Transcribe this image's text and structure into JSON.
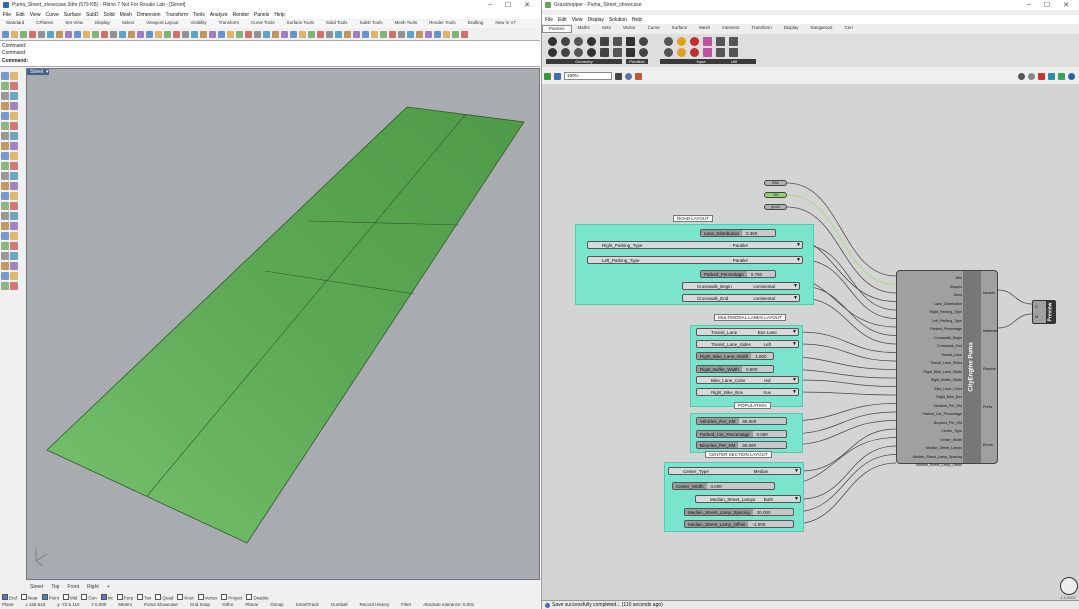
{
  "rhino": {
    "title": "Puma_Street_showcase.3dm (579 KB) - Rhino 7 Not For Resale Lab - [Street]",
    "menu": [
      "File",
      "Edit",
      "View",
      "Curve",
      "Surface",
      "SubD",
      "Solid",
      "Mesh",
      "Dimension",
      "Transform",
      "Tools",
      "Analyze",
      "Render",
      "Panels",
      "Help"
    ],
    "tabs": [
      "Standard",
      "CPlanes",
      "Set View",
      "Display",
      "Select",
      "Viewport Layout",
      "Visibility",
      "Transform",
      "Curve Tools",
      "Surface Tools",
      "Solid Tools",
      "SubD Tools",
      "Mesh Tools",
      "Render Tools",
      "Drafting",
      "New in V7"
    ],
    "command_lines": [
      "Command:",
      "Command:",
      "Command:"
    ],
    "viewport_label": "Street",
    "viewport_tabs": [
      "Street",
      "Top",
      "Front",
      "Right",
      "+"
    ],
    "osnaps": [
      {
        "label": "End",
        "on": true
      },
      {
        "label": "Near",
        "on": false
      },
      {
        "label": "Point",
        "on": true
      },
      {
        "label": "Mid",
        "on": false
      },
      {
        "label": "Cen",
        "on": false
      },
      {
        "label": "Int",
        "on": true
      },
      {
        "label": "Perp",
        "on": false
      },
      {
        "label": "Tan",
        "on": false
      },
      {
        "label": "Quad",
        "on": false
      },
      {
        "label": "Knot",
        "on": false
      },
      {
        "label": "Vertex",
        "on": false
      },
      {
        "label": "Project",
        "on": false
      },
      {
        "label": "Disable",
        "on": false
      }
    ],
    "status": [
      "Plane",
      "x 168.543",
      "y -72.5.110",
      "z 0.000",
      "Meters",
      "Puma Showcase",
      "Grid Snap",
      "Ortho",
      "Planar",
      "Osnap",
      "SmartTrack",
      "Gumball",
      "Record History",
      "Filter",
      "Absolute tolerance: 0.001"
    ],
    "colors": {
      "surface": "#5fae52",
      "viewport_bg": "#a8acb0",
      "surface_edge": "#2f5a2a"
    }
  },
  "grasshopper": {
    "title": "Grasshopper - Puma_Street_showcase",
    "menu": [
      "File",
      "Edit",
      "View",
      "Display",
      "Solution",
      "Help"
    ],
    "tabs": [
      "Params",
      "Maths",
      "Sets",
      "Vector",
      "Curve",
      "Surface",
      "Mesh",
      "Intersect",
      "Transform",
      "Display",
      "Kangaroo2",
      "Ceri"
    ],
    "panel_groups": [
      "Geometry",
      "Primitive",
      "Input",
      "Util"
    ],
    "zoom": "150%",
    "status_message": "Save successfully completed... (110 seconds ago)",
    "version": "1.0.0007",
    "top_nodes": [
      "Bfrk",
      "Srf",
      "proof"
    ],
    "groups": [
      {
        "label": "ROAD LAYOUT",
        "items": [
          {
            "kind": "param",
            "name": "Lane_Distribution",
            "value": "0.350"
          },
          {
            "kind": "dropdown",
            "name": "Right_Parking_Type",
            "value": "Parallel"
          },
          {
            "kind": "dropdown",
            "name": "Left_Parking_Type",
            "value": "Parallel"
          },
          {
            "kind": "param",
            "name": "Parked_Percentage",
            "value": "0.750"
          },
          {
            "kind": "dropdown",
            "name": "Crosswalk_Begin",
            "value": "continental"
          },
          {
            "kind": "dropdown",
            "name": "Crosswalk_End",
            "value": "continental"
          }
        ]
      },
      {
        "label": "MULTIMODAL LANES LAYOUT",
        "items": [
          {
            "kind": "dropdown",
            "name": "Transit_Lane",
            "value": "Bus Lane"
          },
          {
            "kind": "dropdown",
            "name": "Transit_Lane_Sides",
            "value": "Left"
          },
          {
            "kind": "param",
            "name": "Right_Bike_Lane_Width",
            "value": "1.800"
          },
          {
            "kind": "param",
            "name": "Right_Buffer_Width",
            "value": "0.600"
          },
          {
            "kind": "dropdown",
            "name": "Bike_Lane_Color",
            "value": "red"
          },
          {
            "kind": "dropdown",
            "name": "Right_Bike_Box",
            "value": "true"
          }
        ]
      },
      {
        "label": "POPULATION",
        "items": [
          {
            "kind": "param",
            "name": "Vehicles_Per_KM",
            "value": "65.000"
          },
          {
            "kind": "param",
            "name": "Parked_Car_Percentage",
            "value": "0.250"
          },
          {
            "kind": "param",
            "name": "Bicycles_Per_KM",
            "value": "30.000"
          }
        ]
      },
      {
        "label": "CENTER SECTION LAYOUT",
        "items": [
          {
            "kind": "dropdown",
            "name": "Center_Type",
            "value": "Median"
          },
          {
            "kind": "param",
            "name": "Center_Width",
            "value": "3.000"
          },
          {
            "kind": "dropdown",
            "name": "Median_Street_Lamps",
            "value": "Both"
          },
          {
            "kind": "param",
            "name": "Median_Street_Lamp_Spacing",
            "value": "20.000"
          },
          {
            "kind": "param",
            "name": "Median_Street_Lamp_Offset",
            "value": "-1.000"
          }
        ]
      }
    ],
    "component": {
      "name": "CityEngine Puma",
      "inputs": [
        "Bfrk",
        "Shapes",
        "Seed",
        "Lane_Distribution",
        "Right_Parking_Type",
        "Left_Parking_Type",
        "Parked_Percentage",
        "Crosswalk_Begin",
        "Crosswalk_End",
        "Transit_Lane",
        "Transit_Lane_Sides",
        "Right_Bike_Lane_Width",
        "Right_Buffer_Width",
        "Bike_Lane_Color",
        "Right_Bike_Box",
        "Vehicles_Per_KM",
        "Parked_Car_Percentage",
        "Bicycles_Per_KM",
        "Center_Type",
        "Center_Width",
        "Median_Street_Lamps",
        "Median_Street_Lamp_Spacing",
        "Median_Street_Lamp_Offset"
      ],
      "outputs": [
        "Models",
        "Materials",
        "Reports",
        "Prints",
        "Errors"
      ]
    },
    "preview_node": {
      "label": "Preview",
      "inputs": [
        "G",
        "M"
      ]
    }
  }
}
